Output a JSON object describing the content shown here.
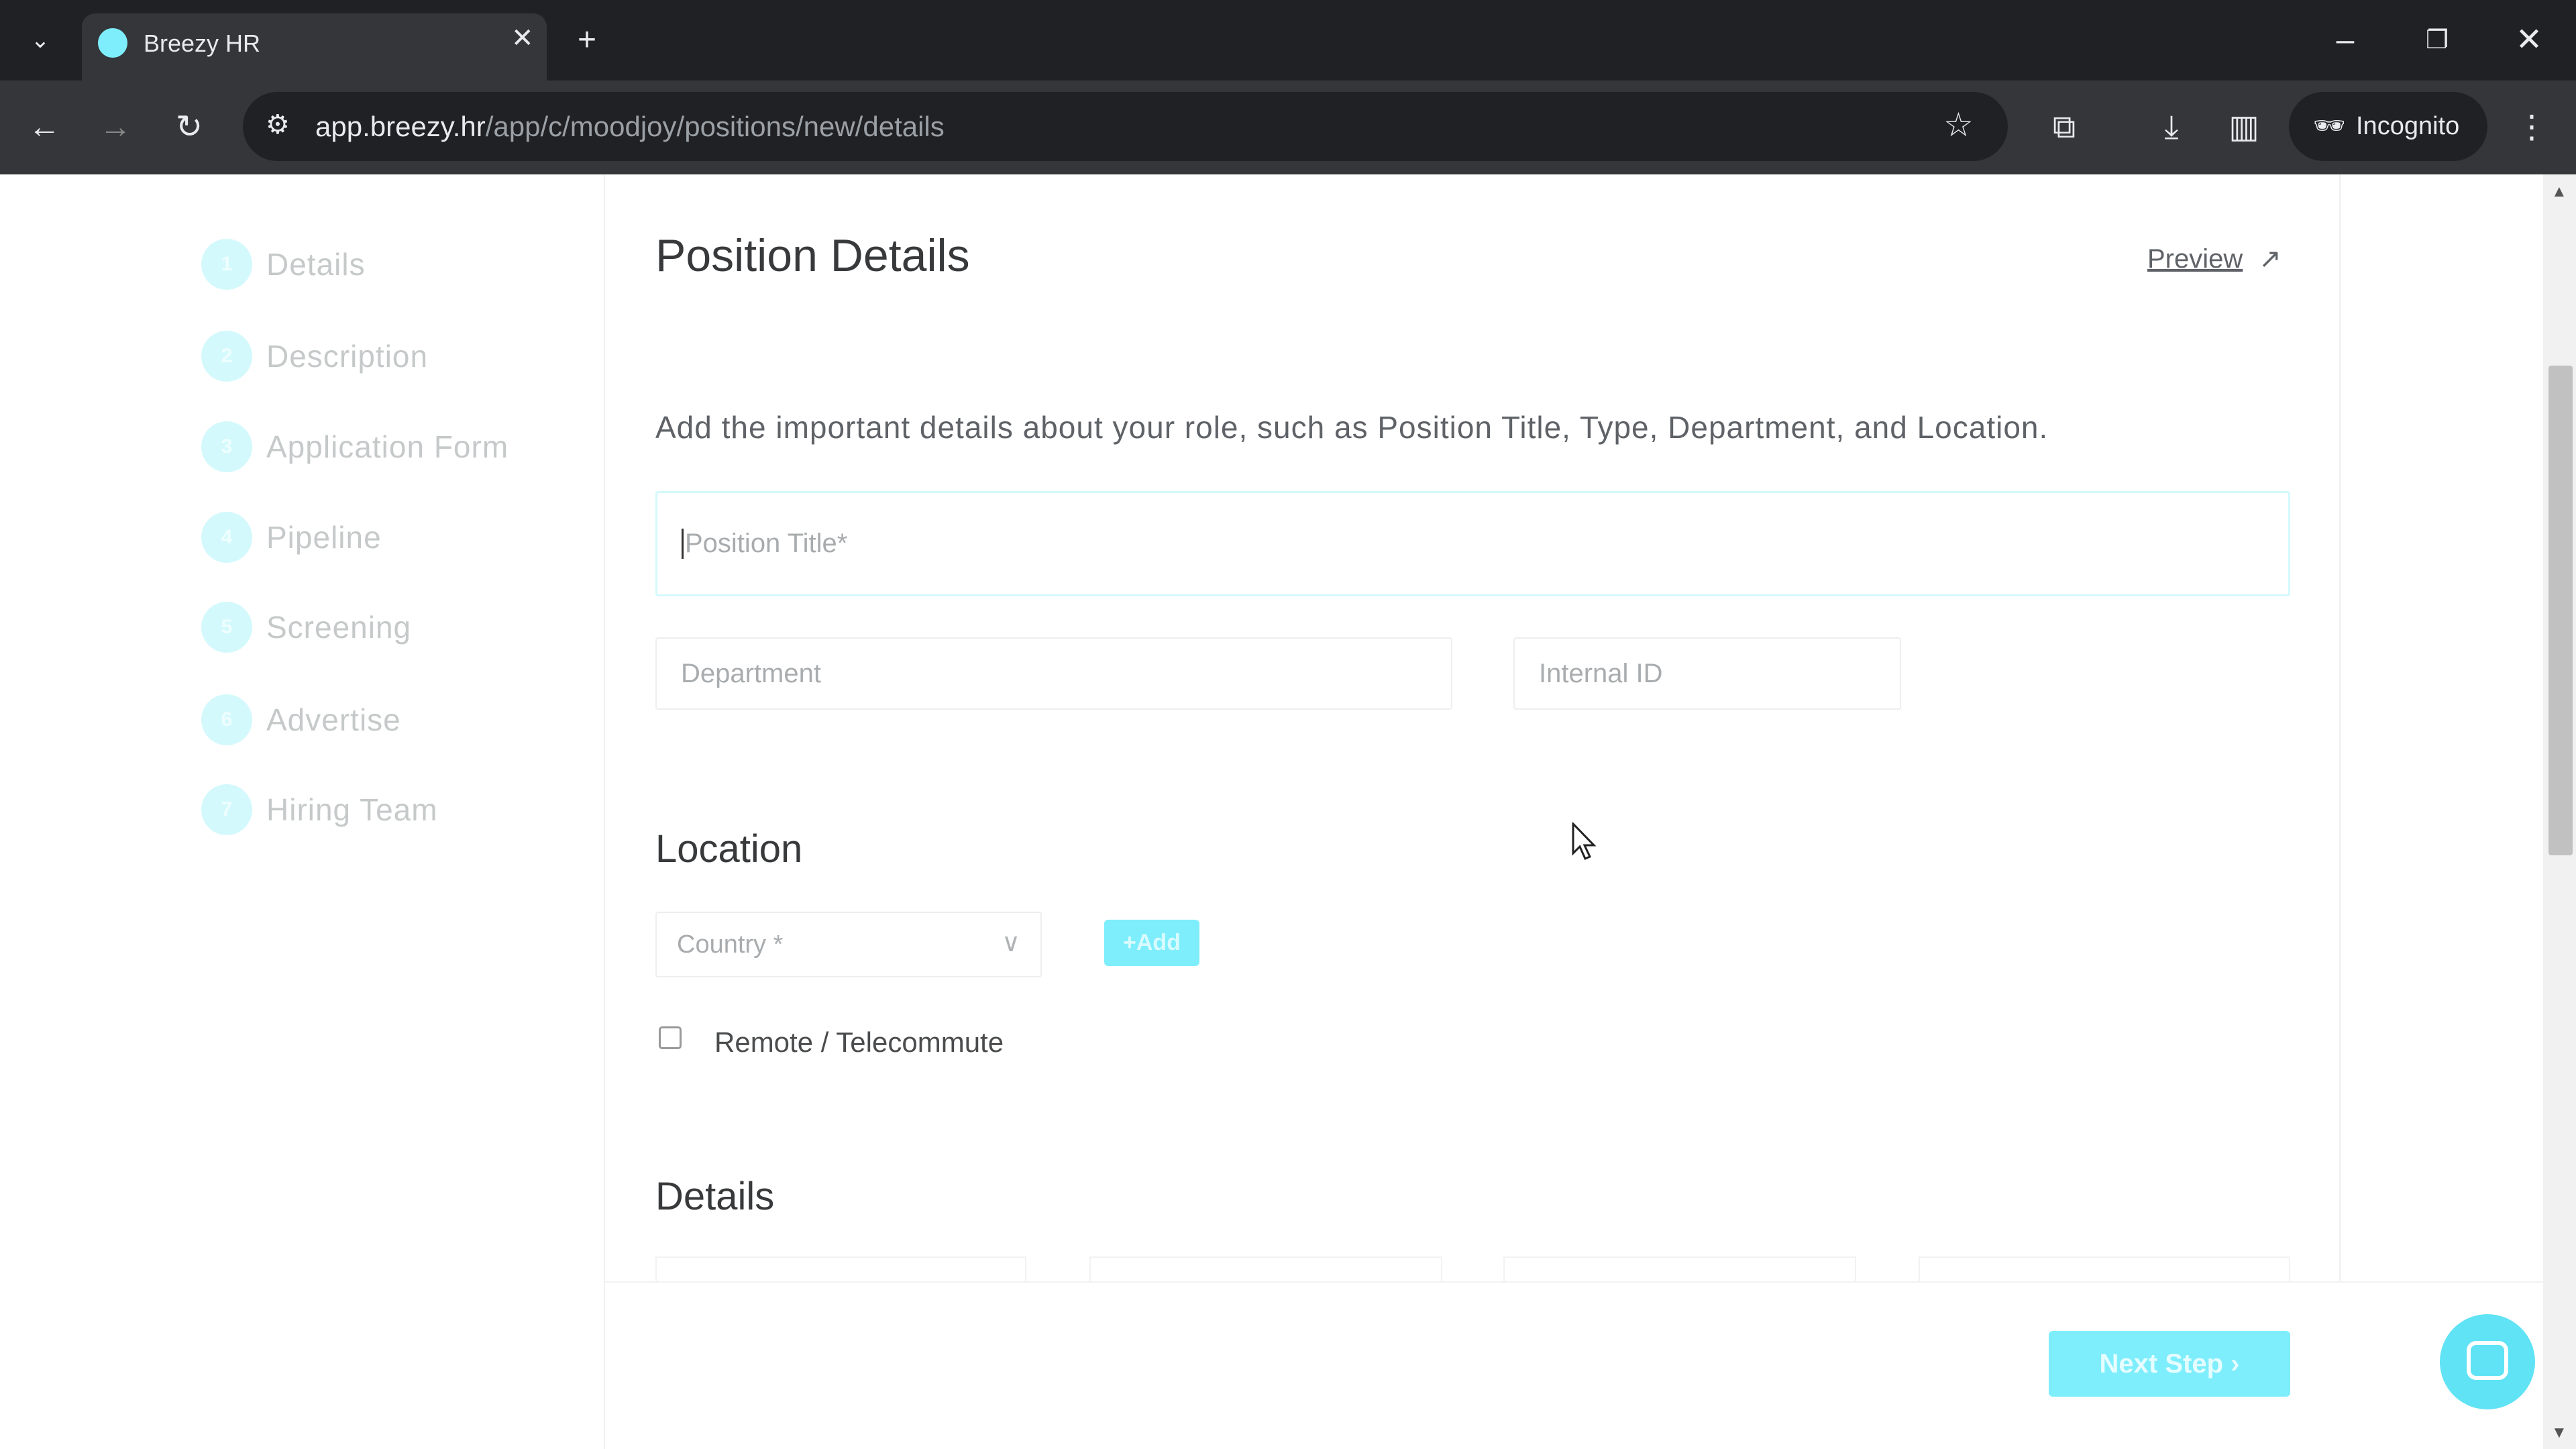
{
  "browser": {
    "tab_title": "Breezy HR",
    "url_host": "app.breezy.hr",
    "url_path": "/app/c/moodjoy/positions/new/details",
    "incognito_label": "Incognito"
  },
  "sidebar": {
    "steps": [
      {
        "number": "1",
        "label": "Details"
      },
      {
        "number": "2",
        "label": "Description"
      },
      {
        "number": "3",
        "label": "Application Form"
      },
      {
        "number": "4",
        "label": "Pipeline"
      },
      {
        "number": "5",
        "label": "Screening"
      },
      {
        "number": "6",
        "label": "Advertise"
      },
      {
        "number": "7",
        "label": "Hiring Team"
      }
    ]
  },
  "main": {
    "title": "Position Details",
    "preview_label": "Preview",
    "description": "Add the important details about your role, such as Position Title, Type, Department, and Location.",
    "position_title_placeholder": "Position Title*",
    "department_placeholder": "Department",
    "internal_id_placeholder": "Internal ID",
    "location_heading": "Location",
    "country_placeholder": "Country *",
    "add_label": "+Add",
    "remote_label": "Remote / Telecommute",
    "details_heading": "Details",
    "next_step_label": "Next Step"
  },
  "colors": {
    "accent": "#7eeefc",
    "accent_light": "#d4f9fc"
  }
}
